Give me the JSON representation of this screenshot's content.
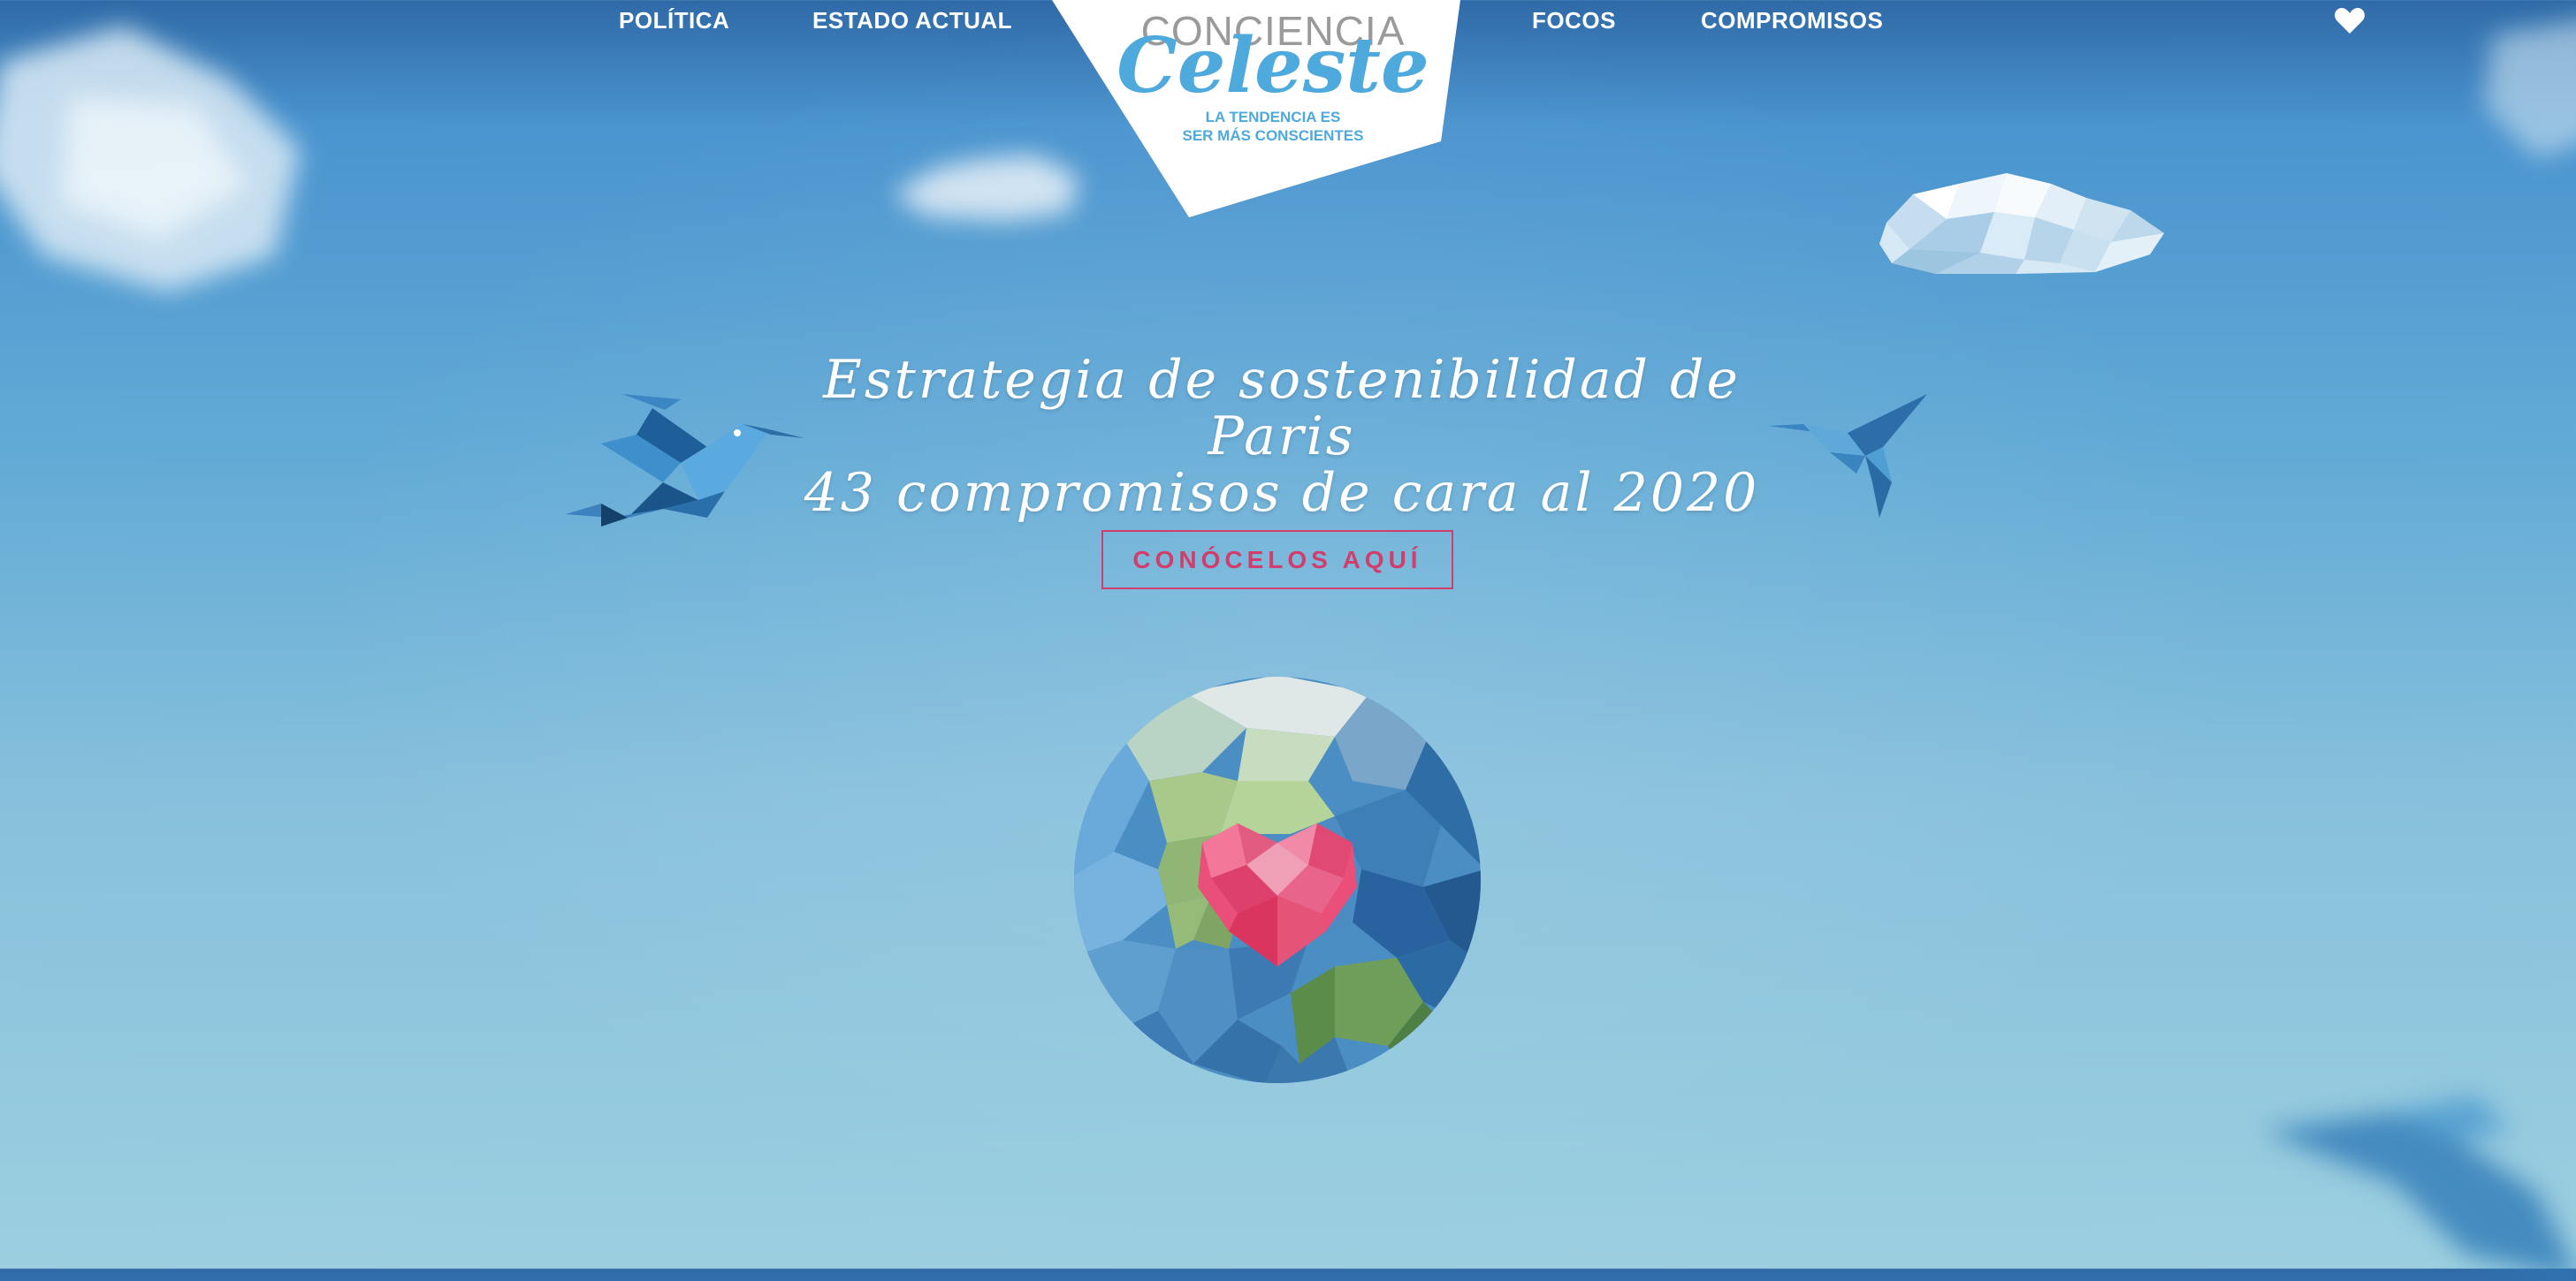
{
  "nav": {
    "left": [
      {
        "label": "POLÍTICA"
      },
      {
        "label": "ESTADO ACTUAL"
      }
    ],
    "right": [
      {
        "label": "FOCOS"
      },
      {
        "label": "COMPROMISOS"
      }
    ],
    "heart_icon": "heart-icon"
  },
  "logo": {
    "title": "CONCIENCIA",
    "script": "Celeste",
    "tagline_line1": "LA TENDENCIA ES",
    "tagline_line2": "SER MÁS CONSCIENTES"
  },
  "hero": {
    "headline_line1": "Estrategia de sostenibilidad de Paris",
    "headline_line2": "43 compromisos de cara al 2020",
    "cta_label": "CONÓCELOS AQUÍ"
  },
  "colors": {
    "accent": "#d23e6b",
    "logo_blue": "#4ea9dc",
    "sky_top": "#2f6aa7",
    "sky_bottom": "#9ccfe0"
  }
}
